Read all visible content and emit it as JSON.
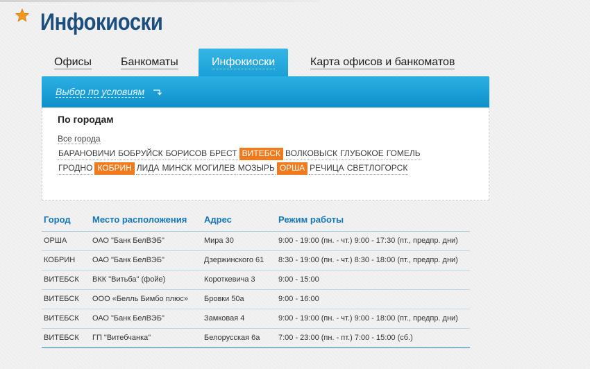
{
  "header": {
    "title": "Инфокиоски"
  },
  "tabs": [
    {
      "label": "Офисы",
      "active": false
    },
    {
      "label": "Банкоматы",
      "active": false
    },
    {
      "label": "Инфокиоски",
      "active": true
    },
    {
      "label": "Карта офисов и банкоматов",
      "active": false
    }
  ],
  "filter": {
    "toggle_label": "Выбор по условиям",
    "heading": "По городам",
    "all_cities": "Все города",
    "cities_row1": [
      "БАРАНОВИЧИ",
      "БОБРУЙСК",
      "БОРИСОВ",
      "БРЕСТ",
      "ВИТЕБСК",
      "ВОЛКОВЫСК",
      "ГЛУБОКОЕ",
      "ГОМЕЛЬ"
    ],
    "cities_row2": [
      "ГРОДНО",
      "КОБРИН",
      "ЛИДА",
      "МИНСК",
      "МОГИЛЕВ",
      "МОЗЫРЬ",
      "ОРША",
      "РЕЧИЦА",
      "СВЕТЛОГОРСК"
    ],
    "selected": [
      "ВИТЕБСК",
      "КОБРИН",
      "ОРША"
    ]
  },
  "table": {
    "headers": [
      "Город",
      "Место расположения",
      "Адрес",
      "Режим работы"
    ],
    "rows": [
      [
        "ОРША",
        "ОАО \"Банк БелВЭБ\"",
        "Мира 30",
        "9:00 - 19:00 (пн. - чт.) 9:00 - 17:30 (пт., предпр. дни)"
      ],
      [
        "КОБРИН",
        "ОАО \"Банк БелВЭБ\"",
        "Дзержинского 61",
        "8:30 - 19:00 (пн. - чт.) 8:30 - 18:00 (пт., предпр. дни)"
      ],
      [
        "ВИТЕБСК",
        "ВКК \"Витьба\" (фойе)",
        "Короткевича 3",
        "9:00 - 15:00"
      ],
      [
        "ВИТЕБСК",
        "ООО «Белль Бимбо плюс»",
        "Бровки 50а",
        "9:00 - 16:00"
      ],
      [
        "ВИТЕБСК",
        "ОАО \"Банк БелВЭБ\"",
        "Замковая 4",
        "9:00 - 19:00 (пн. - чт.) 9:00 - 18:00 (пт., предпр. дни)"
      ],
      [
        "ВИТЕБСК",
        "ГП \"Витебчанка\"",
        "Белорусская 6а",
        "7:00 - 23:00 (пн. - пт.) 7:00 - 15:00 (сб.)"
      ]
    ]
  },
  "colors": {
    "accent_blue": "#1a9fd6",
    "title_blue": "#1c4f80",
    "selected_orange": "#f07a1c",
    "star_orange": "#f39a1c"
  },
  "icons": {
    "favorite": "star-icon",
    "filter_toggle": "arrow-corner-icon"
  }
}
